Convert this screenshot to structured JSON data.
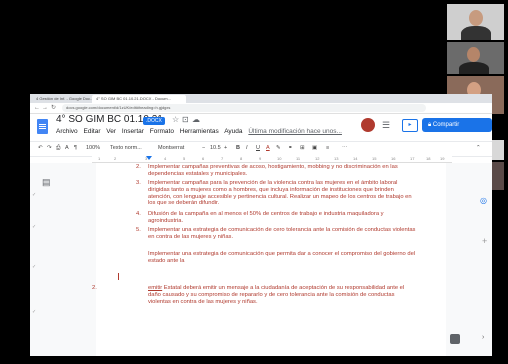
{
  "browser": {
    "tabs": [
      {
        "label": "4 Gestión de Inf. - Google Doc..."
      },
      {
        "label": "4° SO GIM BC 01.10.21.DOCX - Docum..."
      }
    ],
    "url": "docs.google.com/document/d/1zUK/edit#heading=h.gjdgxs"
  },
  "docs": {
    "title": "4° SO GIM BC 01.10.21",
    "badge": ".DOCX",
    "menu": [
      "Archivo",
      "Editar",
      "Ver",
      "Insertar",
      "Formato",
      "Herramientas",
      "Ayuda"
    ],
    "last_edit": "Última modificación hace unos...",
    "share_label": "Compartir"
  },
  "toolbar": {
    "zoom": "100%",
    "style": "Texto norm...",
    "font": "Montserrat",
    "size": "10.5",
    "bold": "B",
    "italic": "I",
    "underline": "U",
    "textcolor": "A"
  },
  "ruler": [
    "1",
    "2",
    "3",
    "4",
    "5",
    "6",
    "7",
    "8",
    "9",
    "10",
    "11",
    "12",
    "13",
    "14",
    "15",
    "16",
    "17",
    "18",
    "19"
  ],
  "document": {
    "items": [
      {
        "num": "2.",
        "text": "Implementar campañas preventivas de acoso, hostigamiento, mobbing y no discriminación en las dependencias estatales y municipales."
      },
      {
        "num": "3.",
        "text": "Implementar campañas para la prevención de la violencia contra las mujeres en el ámbito laboral dirigidas tanto a mujeres como a hombres, que incluya información de instituciones que brinden atención, con lenguaje accesible y pertinencia cultural. Realizar un mapeo de los centros de trabajo en los que se deberán difundir."
      },
      {
        "num": "4.",
        "text": "Difusión de la campaña en al menos el 50% de centros de trabajo e industria maquiladora y agroindustria."
      },
      {
        "num": "5.",
        "text": "Implementar una estrategia de comunicación de cero tolerancia ante la comisión de conductas violentas en contra de las mujeres y niñas."
      }
    ],
    "paragraph": "Implementar una estrategia de comunicación que permita dar a conocer el compromiso del gobierno del estado ante la",
    "item_last_num": "2.",
    "item_last_word": "emitir",
    "item_last_text": " Estatal deberá emitir un mensaje a la ciudadanía de aceptación de su responsabilidad ante el daño causado y su compromiso de repararlo y de cero tolerancia ante la comisión de conductas violentas en contra de las mujeres y niñas."
  }
}
